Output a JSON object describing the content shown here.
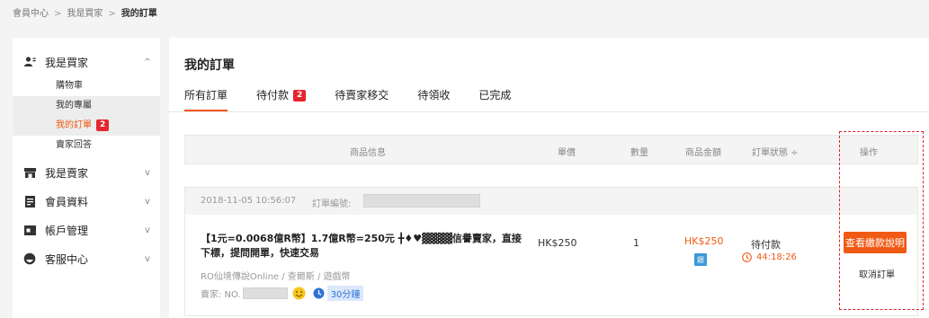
{
  "breadcrumb": {
    "items": [
      "會員中心",
      "我是買家"
    ],
    "current": "我的訂單",
    "separator": ">"
  },
  "sidebar": {
    "buyer": {
      "label": "我是買家",
      "chevron": "^",
      "icon": "buyer-icon"
    },
    "buyer_items": [
      {
        "label": "購物車"
      },
      {
        "label": "我的專屬"
      },
      {
        "label": "我的訂單",
        "badge": "2"
      },
      {
        "label": "賣家回答"
      }
    ],
    "seller": {
      "label": "我是賣家",
      "chevron": "v",
      "icon": "store-icon"
    },
    "member": {
      "label": "會員資料",
      "chevron": "v",
      "icon": "document-icon"
    },
    "account": {
      "label": "帳戶管理",
      "chevron": "v",
      "icon": "card-icon"
    },
    "service": {
      "label": "客服中心",
      "chevron": "v",
      "icon": "headset-icon"
    }
  },
  "main": {
    "title": "我的訂單",
    "tabs": [
      {
        "label": "所有訂單"
      },
      {
        "label": "待付款",
        "badge": "2"
      },
      {
        "label": "待賣家移交"
      },
      {
        "label": "待領收"
      },
      {
        "label": "已完成"
      }
    ],
    "columns": {
      "info": "商品信息",
      "price": "單價",
      "qty": "數量",
      "amount": "商品金額",
      "status": "訂單狀態 ÷",
      "action": "操作"
    }
  },
  "order": {
    "date": "2018-11-05 10:56:07",
    "number_label": "訂單編號:",
    "title": "【1元=0.0068億R幣】1.7億R幣=250元 ╋♦♥▓▓▓▓信譽賣家，直接下標，提問開單，快速交易",
    "game": "RO仙境傳說Online / 查爾斯 / 遊戲幣",
    "seller_label": "賣家: NO.",
    "delivery": "30分鐘",
    "price": "HK$250",
    "quantity": "1",
    "amount": "HK$250",
    "bank_label": "銀",
    "status": "待付款",
    "timer": "44:18:26",
    "view_button": "查看繳款說明",
    "cancel_link": "取消訂單"
  },
  "colors": {
    "accent": "#f05a14",
    "badge": "#e4262c",
    "highlight_box": "#d9242b",
    "bank": "#3b99d8"
  }
}
